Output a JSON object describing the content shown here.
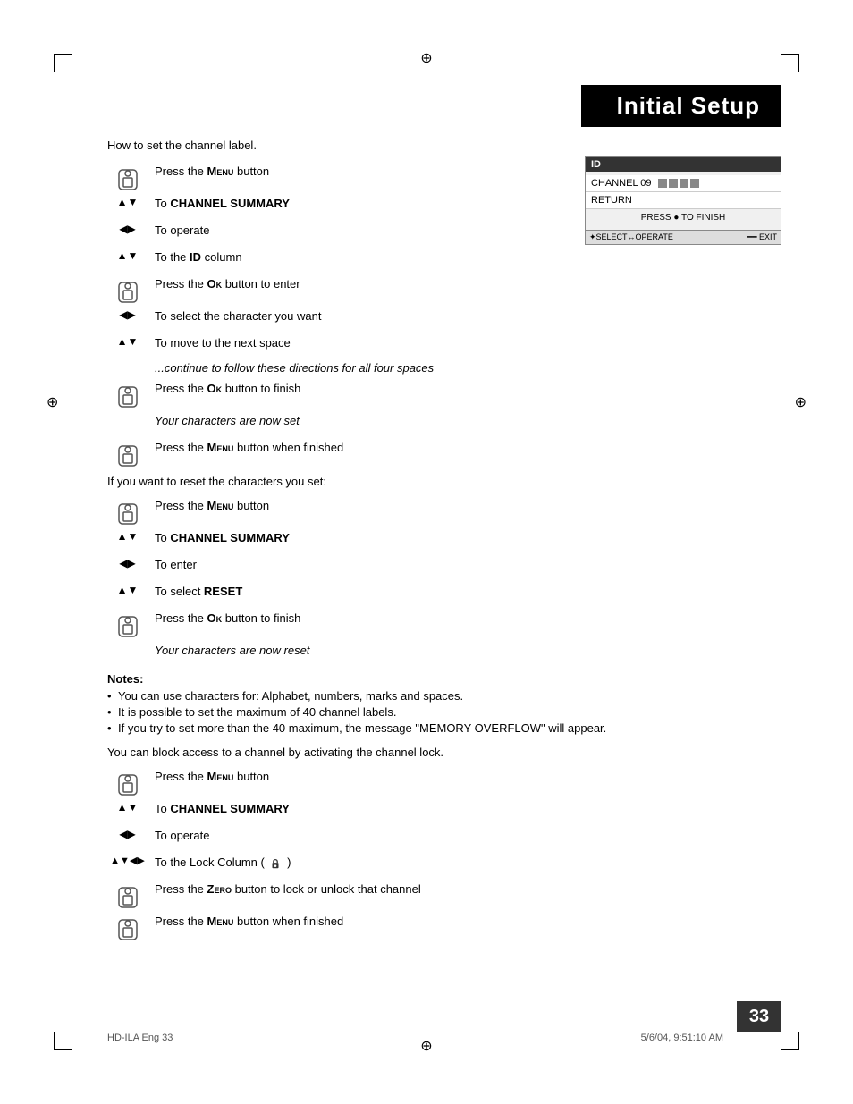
{
  "page": {
    "title": "Initial Setup",
    "page_number": "33",
    "footer_left": "HD-ILA Eng  33",
    "footer_right": "5/6/04, 9:51:10 AM"
  },
  "intro": "How to set the channel label.",
  "sections": {
    "channel_label": [
      {
        "icon": "remote",
        "text": "Press the MENU button"
      },
      {
        "icon": "updown",
        "text": "To CHANNEL SUMMARY"
      },
      {
        "icon": "leftright",
        "text": "To operate"
      },
      {
        "icon": "updown",
        "text": "To the ID column"
      },
      {
        "icon": "remote",
        "text": "Press the OK button to enter"
      },
      {
        "icon": "leftright",
        "text": "To select the character you want"
      },
      {
        "icon": "updown",
        "text": "To move to the next space"
      }
    ],
    "continue_text": "...continue to follow these directions for all four spaces",
    "channel_label2": [
      {
        "icon": "remote",
        "text": "Press the OK button to finish"
      },
      {
        "icon": "none",
        "text_italic": "Your characters are now set"
      },
      {
        "icon": "remote",
        "text": "Press the MENU button when finished"
      }
    ],
    "reset_intro": "If you want to reset the characters you set:",
    "reset": [
      {
        "icon": "remote",
        "text": "Press the MENU button"
      },
      {
        "icon": "updown",
        "text": "To CHANNEL SUMMARY"
      },
      {
        "icon": "leftright",
        "text": "To enter"
      },
      {
        "icon": "updown",
        "text": "To select RESET"
      },
      {
        "icon": "remote",
        "text": "Press the OK button to finish"
      },
      {
        "icon": "none",
        "text_italic": "Your characters are now reset"
      }
    ],
    "notes_title": "Notes:",
    "notes": [
      "You can use characters for: Alphabet, numbers, marks and spaces.",
      "It is possible to set the maximum of 40 channel labels.",
      "If you try to set more than the 40 maximum, the message \"MEMORY OVERFLOW\" will appear."
    ],
    "lock_intro": "You can block access to a channel by activating the channel lock.",
    "lock": [
      {
        "icon": "remote",
        "text": "Press the MENU button"
      },
      {
        "icon": "updown",
        "text": "To CHANNEL SUMMARY"
      },
      {
        "icon": "leftright",
        "text": "To operate"
      },
      {
        "icon": "all",
        "text": "To the Lock Column ( 🔒 )"
      },
      {
        "icon": "remote",
        "text": "Press the ZERO button to lock or unlock that channel"
      },
      {
        "icon": "remote",
        "text": "Press the MENU button when finished"
      }
    ]
  },
  "screen": {
    "header": "ID",
    "channel_row": "CHANNEL 09",
    "return_row": "RETURN",
    "press_text": "PRESS ● TO FINISH",
    "footer_left": "✦SELECT↔OPERATE",
    "footer_right": "━━ EXIT"
  }
}
